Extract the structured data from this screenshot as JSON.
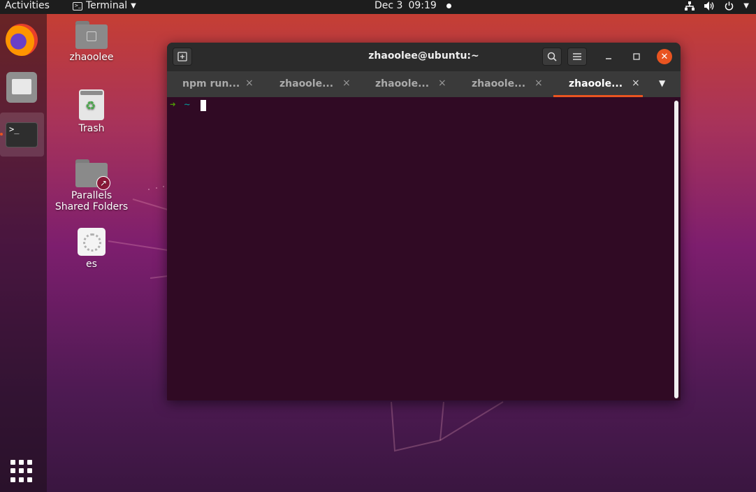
{
  "topbar": {
    "activities": "Activities",
    "app_name": "Terminal",
    "date": "Dec 3",
    "time": "09:19"
  },
  "dock": {
    "items": [
      "firefox",
      "files",
      "terminal"
    ],
    "show_apps": "show-applications"
  },
  "desktop": {
    "icons": [
      {
        "label": "zhaoolee",
        "icon": "home-folder-icon"
      },
      {
        "label": "Trash",
        "icon": "trash-icon"
      },
      {
        "label": "Parallels Shared Folders",
        "icon": "folder-link-icon"
      },
      {
        "label": "es",
        "icon": "settings-icon"
      }
    ]
  },
  "window": {
    "title": "zhaoolee@ubuntu:~",
    "tabs": [
      {
        "label": "npm run...",
        "active": false
      },
      {
        "label": "zhaoole...",
        "active": false
      },
      {
        "label": "zhaoole...",
        "active": false
      },
      {
        "label": "zhaoole...",
        "active": false
      },
      {
        "label": "zhaoole...",
        "active": true
      }
    ],
    "tab_close": "×",
    "prompt_arrow": "➜",
    "prompt_dir": "~"
  },
  "colors": {
    "accent": "#e95420",
    "terminal_bg": "#300a24",
    "prompt_arrow": "#4e9a06",
    "prompt_dir": "#06989a"
  }
}
